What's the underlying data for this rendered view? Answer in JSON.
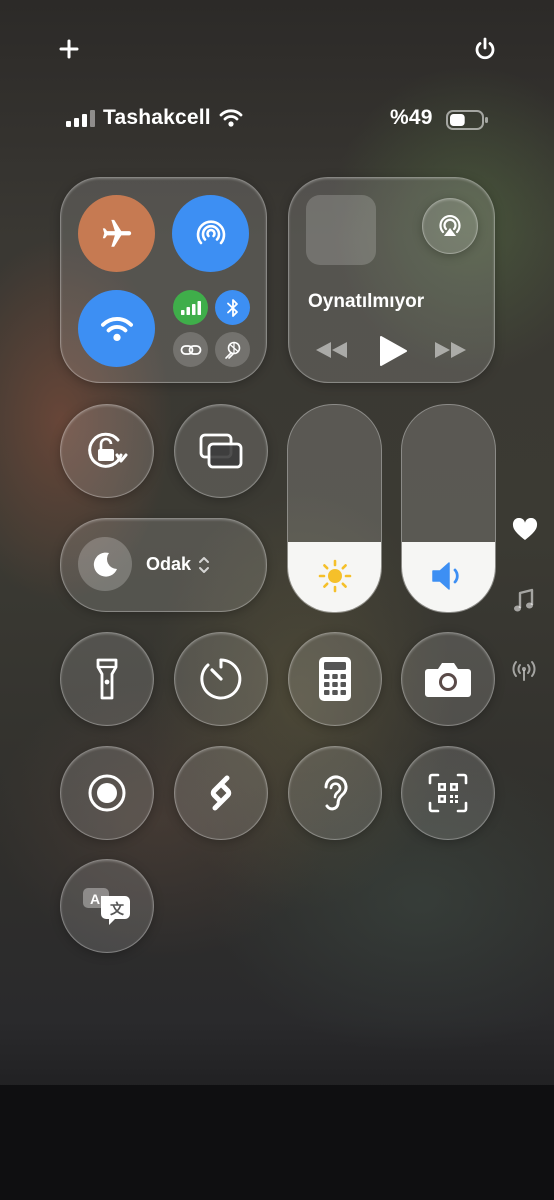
{
  "status": {
    "carrier": "Tashakcell",
    "battery": "%49",
    "battery_level": 0.49
  },
  "top_controls": {
    "add_icon": "plus-icon",
    "power_icon": "power-icon"
  },
  "connectivity": {
    "airplane": {
      "icon": "airplane-icon",
      "color": "#c67a52"
    },
    "airdrop": {
      "icon": "airdrop-icon",
      "color": "#3d8ff3"
    },
    "wifi": {
      "icon": "wifi-icon",
      "color": "#3d8ff3"
    },
    "cellular": {
      "icon": "cellular-data-icon",
      "color": "#3fae4a"
    },
    "bluetooth": {
      "icon": "bluetooth-icon",
      "color": "#3d8ff3"
    },
    "personal_hotspot": {
      "icon": "link-icon"
    },
    "satellite": {
      "icon": "satellite-icon"
    }
  },
  "media": {
    "status": "Oynatılmıyor"
  },
  "focus": {
    "label": "Odak"
  },
  "sliders": {
    "brightness_icon": "sun-icon",
    "volume_icon": "speaker-icon"
  },
  "side_indicators": [
    "heart-icon",
    "music-note-icon",
    "antenna-icon"
  ]
}
